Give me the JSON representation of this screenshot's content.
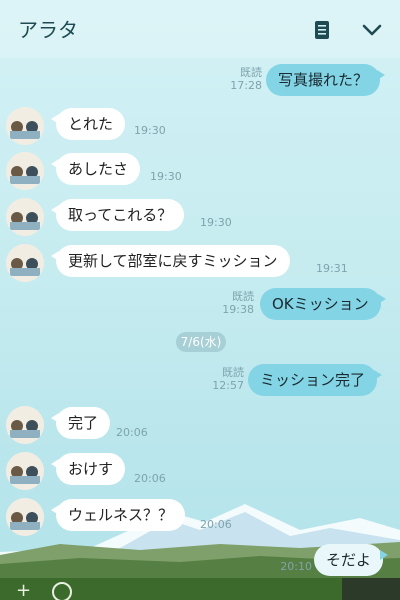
{
  "header": {
    "title": "アラタ",
    "menu_icon": "list-icon",
    "chevron_icon": "chevron-down-icon"
  },
  "read_label": "既読",
  "date_chip": "7/6(水)",
  "messages": [
    {
      "dir": "out",
      "text": "写真撮れた？",
      "time": "17:28",
      "read": true
    },
    {
      "dir": "in",
      "text": "とれた",
      "time": "19:30"
    },
    {
      "dir": "in",
      "text": "あしたさ",
      "time": "19:30"
    },
    {
      "dir": "in",
      "text": "取ってこれる？",
      "time": "19:30"
    },
    {
      "dir": "in",
      "text": "更新して部室に戻すミッション",
      "time": "19:31"
    },
    {
      "dir": "out",
      "text": "OKミッション",
      "time": "19:38",
      "read": true
    },
    {
      "dir": "out",
      "text": "ミッション完了",
      "time": "12:57",
      "read": true
    },
    {
      "dir": "in",
      "text": "完了",
      "time": "20:06"
    },
    {
      "dir": "in",
      "text": "おけす",
      "time": "20:06"
    },
    {
      "dir": "in",
      "text": "ウェルネス？？",
      "time": "20:06"
    },
    {
      "dir": "out",
      "text": "そだよ",
      "time": "20:10"
    }
  ]
}
